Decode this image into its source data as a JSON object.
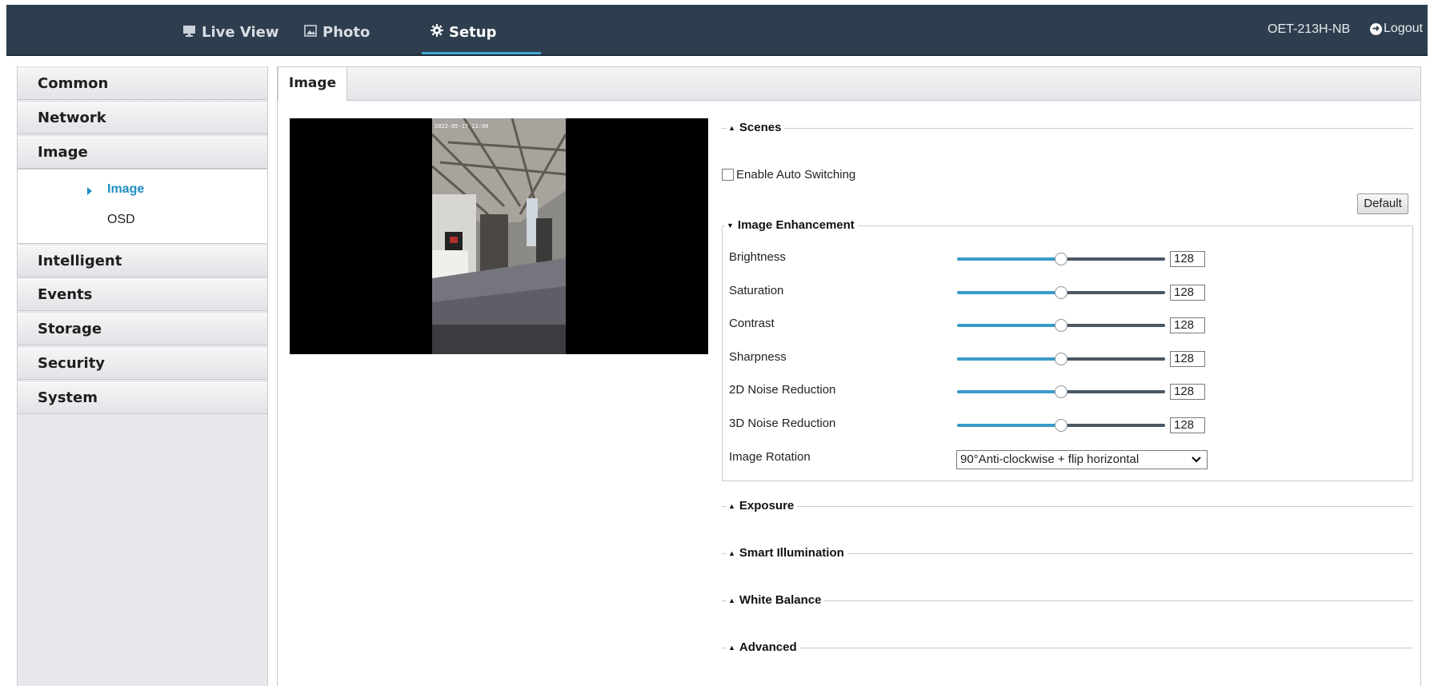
{
  "nav": {
    "live_view": "Live View",
    "photo": "Photo",
    "setup": "Setup",
    "active": "setup",
    "device_name": "OET-213H-NB",
    "logout": "Logout"
  },
  "sidebar": {
    "items": [
      {
        "label": "Common"
      },
      {
        "label": "Network"
      },
      {
        "label": "Image"
      },
      {
        "label": "Intelligent"
      },
      {
        "label": "Events"
      },
      {
        "label": "Storage"
      },
      {
        "label": "Security"
      },
      {
        "label": "System"
      }
    ],
    "image_sub": [
      {
        "label": "Image",
        "active": true
      },
      {
        "label": "OSD",
        "active": false
      }
    ]
  },
  "tab": {
    "label": "Image"
  },
  "sections": {
    "scenes": "Scenes",
    "enable_auto_switching": "Enable Auto Switching",
    "default_button": "Default",
    "image_enhancement": "Image Enhancement",
    "exposure": "Exposure",
    "smart_illumination": "Smart Illumination",
    "white_balance": "White Balance",
    "advanced": "Advanced"
  },
  "enhancement": {
    "rows": [
      {
        "label": "Brightness",
        "value": "128",
        "level": 0.5
      },
      {
        "label": "Saturation",
        "value": "128",
        "level": 0.5
      },
      {
        "label": "Contrast",
        "value": "128",
        "level": 0.5
      },
      {
        "label": "Sharpness",
        "value": "128",
        "level": 0.5
      },
      {
        "label": "2D Noise Reduction",
        "value": "128",
        "level": 0.5
      },
      {
        "label": "3D Noise Reduction",
        "value": "128",
        "level": 0.5
      }
    ],
    "rotation_label": "Image Rotation",
    "rotation_value": "90°Anti-clockwise + flip horizontal"
  },
  "preview": {
    "timestamp": "2022-05-17 11:00"
  },
  "colors": {
    "accent": "#1f8fc5",
    "topbar": "#2f3e4e",
    "slider_fill": "#3a9bc9"
  }
}
